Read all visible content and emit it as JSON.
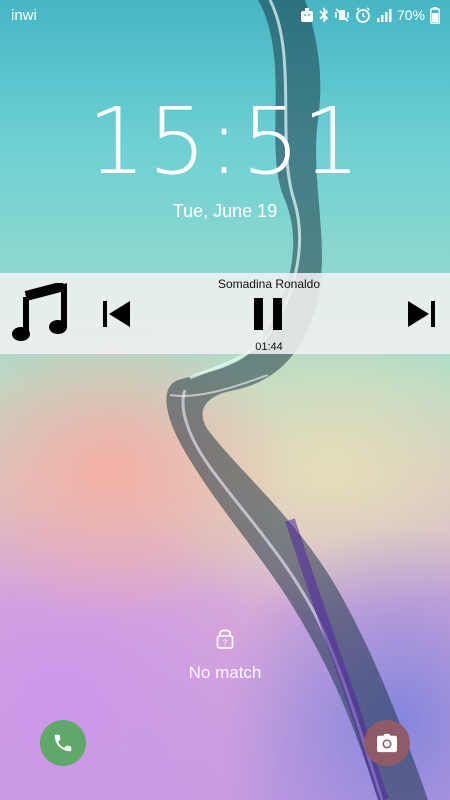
{
  "status_bar": {
    "carrier": "inwi",
    "battery_percent": "70%",
    "icons": [
      "android-debug-icon",
      "bluetooth-icon",
      "mute-vibrate-icon",
      "alarm-icon",
      "signal-icon",
      "battery-icon"
    ]
  },
  "lockscreen": {
    "time": "15:51",
    "date": "Tue, June 19",
    "fingerprint_message": "No match"
  },
  "media": {
    "track_title": "Somadina Ronaldo",
    "elapsed": "01:44",
    "state": "playing"
  },
  "shortcuts": {
    "left": "phone-icon",
    "right": "camera-icon"
  },
  "colors": {
    "phone_button": "#5fa86a",
    "camera_button": "#8d5c66",
    "media_bar": "#f0f0f0"
  }
}
